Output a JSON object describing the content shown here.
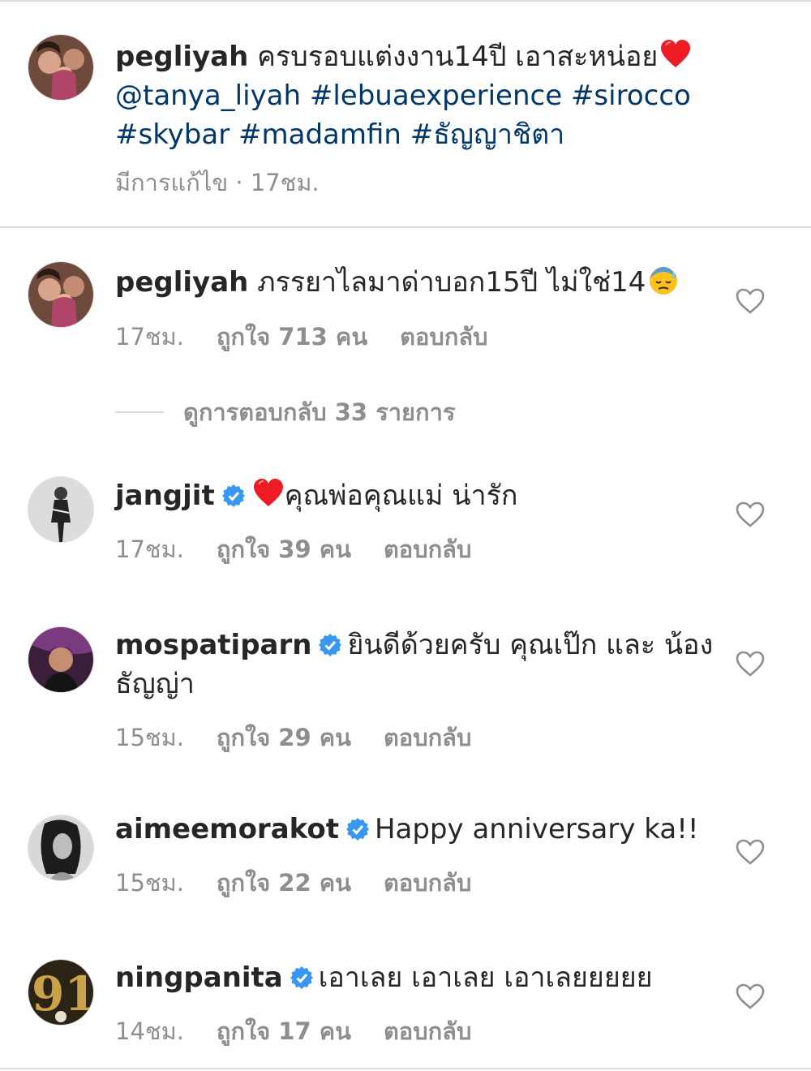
{
  "caption": {
    "username": "pegliyah",
    "text": "ครบรอบแต่งงาน14ปี เอาสะหน่อย",
    "emoji": "red-heart",
    "links": "@tanya_liyah #lebuaexperience #sirocco #skybar #madamfin #ธัญญาชิตา",
    "meta": "มีการแก้ไข · 17ชม."
  },
  "comments": [
    {
      "username": "pegliyah",
      "verified": false,
      "text": "ภรรยาไลมาด่าบอก15ปี ไม่ใช่14",
      "emoji": "downcast-sweat-face",
      "time": "17ชม.",
      "likes": "ถูกใจ 713 คน",
      "reply": "ตอบกลับ"
    },
    {
      "username": "jangjit",
      "verified": true,
      "emoji": "red-heart",
      "text": "คุณพ่อคุณแม่ น่ารัก",
      "time": "17ชม.",
      "likes": "ถูกใจ 39 คน",
      "reply": "ตอบกลับ"
    },
    {
      "username": "mospatiparn",
      "verified": true,
      "text": "ยินดีด้วยครับ คุณเป๊ก และ น้องธัญญ่า",
      "time": "15ชม.",
      "likes": "ถูกใจ 29 คน",
      "reply": "ตอบกลับ"
    },
    {
      "username": "aimeemorakot",
      "verified": true,
      "text": "Happy anniversary ka!!",
      "time": "15ชม.",
      "likes": "ถูกใจ 22 คน",
      "reply": "ตอบกลับ"
    },
    {
      "username": "ningpanita",
      "verified": true,
      "text": "เอาเลย เอาเลย เอาเลยยยยย",
      "time": "14ชม.",
      "likes": "ถูกใจ 17 คน",
      "reply": "ตอบกลับ"
    }
  ],
  "view_replies": "ดูการตอบกลับ 33 รายการ",
  "colors": {
    "link": "#00376b",
    "meta": "#8e8e8e",
    "verified": "#3897f0",
    "heart_emoji": "#ed1c24"
  }
}
